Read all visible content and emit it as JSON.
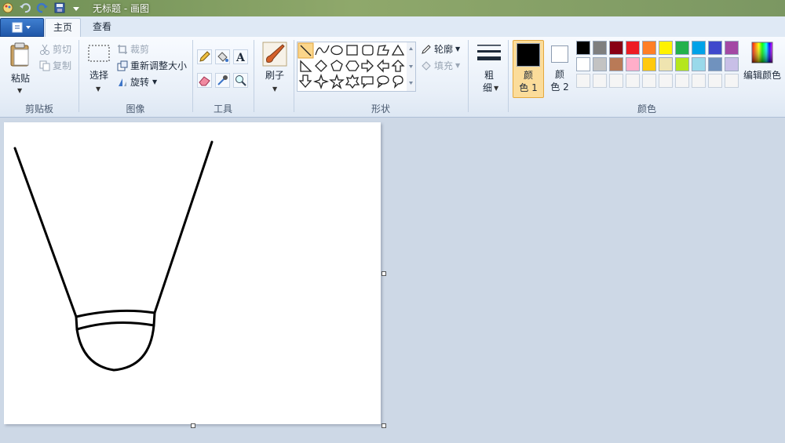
{
  "window": {
    "title": "无标题 - 画图"
  },
  "tabs": [
    {
      "label": "主页",
      "active": true
    },
    {
      "label": "查看",
      "active": false
    }
  ],
  "ribbon": {
    "clipboard": {
      "label": "剪贴板",
      "paste": "粘贴",
      "cut": "剪切",
      "copy": "复制"
    },
    "image": {
      "label": "图像",
      "select": "选择",
      "crop": "裁剪",
      "resize": "重新调整大小",
      "rotate": "旋转"
    },
    "tools": {
      "label": "工具"
    },
    "brushes": {
      "label": "刷子"
    },
    "shapes": {
      "label": "形状",
      "outline": "轮廓",
      "fill": "填充"
    },
    "size": {
      "label_top": "粗",
      "label_bottom": "细"
    },
    "colors": {
      "label": "颜色",
      "color1": {
        "label_top": "颜",
        "label_bottom": "色 1",
        "value": "#000000"
      },
      "color2": {
        "label_top": "颜",
        "label_bottom": "色 2",
        "value": "#ffffff"
      },
      "edit": "编辑颜色",
      "palette_row1": [
        "#000000",
        "#7f7f7f",
        "#880015",
        "#ed1c24",
        "#ff7f27",
        "#fff200",
        "#22b14c",
        "#00a2e8",
        "#3f48cc",
        "#a349a4"
      ],
      "palette_row2": [
        "#ffffff",
        "#c3c3c3",
        "#b97a57",
        "#ffaec9",
        "#ffc90e",
        "#efe4b0",
        "#b5e61d",
        "#99d9ea",
        "#7092be",
        "#c8bfe7"
      ],
      "palette_row3": [
        "#f5f5f5",
        "#f5f5f5",
        "#f5f5f5",
        "#f5f5f5",
        "#f5f5f5",
        "#f5f5f5",
        "#f5f5f5",
        "#f5f5f5",
        "#f5f5f5",
        "#f5f5f5"
      ]
    }
  }
}
